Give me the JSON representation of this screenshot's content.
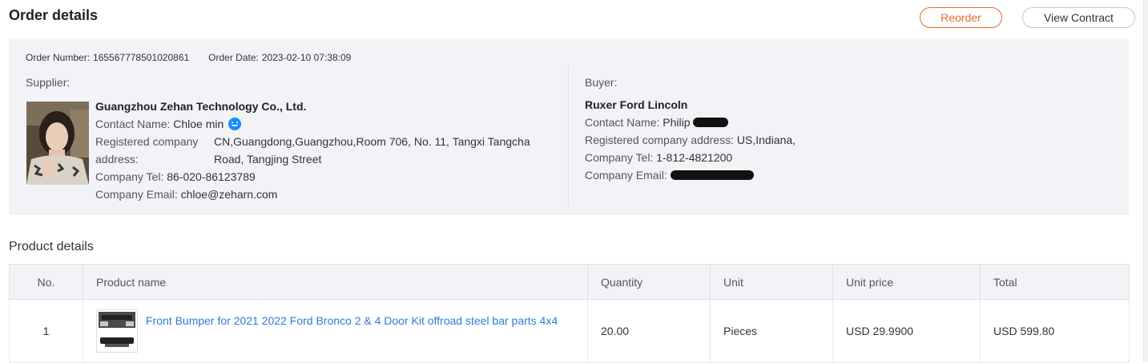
{
  "header": {
    "title": "Order details",
    "reorder_label": "Reorder",
    "view_contract_label": "View Contract"
  },
  "order": {
    "number_label": "Order Number:",
    "number": "165567778501020861",
    "date_label": "Order Date:",
    "date": "2023-02-10 07:38:09"
  },
  "supplier": {
    "section_label": "Supplier:",
    "company": "Guangzhou Zehan Technology Co., Ltd.",
    "contact_label": "Contact Name:",
    "contact": "Chloe min",
    "address_label_1": "Registered company",
    "address_label_2": "address:",
    "address_line_1": "CN,Guangdong,Guangzhou,Room 706, No. 11, Tangxi Tangcha",
    "address_line_2": "Road, Tangjing Street",
    "tel_label": "Company Tel:",
    "tel": "86-020-86123789",
    "email_label": "Company Email:",
    "email": "chloe@zeharn.com"
  },
  "buyer": {
    "section_label": "Buyer:",
    "company": "Ruxer Ford Lincoln",
    "contact_label": "Contact Name:",
    "contact": "Philip",
    "address_label": "Registered company address:",
    "address": "US,Indiana,",
    "tel_label": "Company Tel:",
    "tel": "1-812-4821200",
    "email_label": "Company Email:"
  },
  "products": {
    "section_title": "Product details",
    "columns": [
      "No.",
      "Product name",
      "Quantity",
      "Unit",
      "Unit price",
      "Total"
    ],
    "rows": [
      {
        "no": "1",
        "name": "Front Bumper for 2021 2022 Ford Bronco 2 & 4 Door Kit offroad steel bar parts 4x4",
        "quantity": "20.00",
        "unit": "Pieces",
        "unit_price": "USD 29.9900",
        "total": "USD 599.80"
      }
    ]
  },
  "colors": {
    "accent": "#e86a2c",
    "link": "#2f7bd8",
    "panel_bg": "#f2f3f7",
    "chat": "#1a8cff"
  }
}
